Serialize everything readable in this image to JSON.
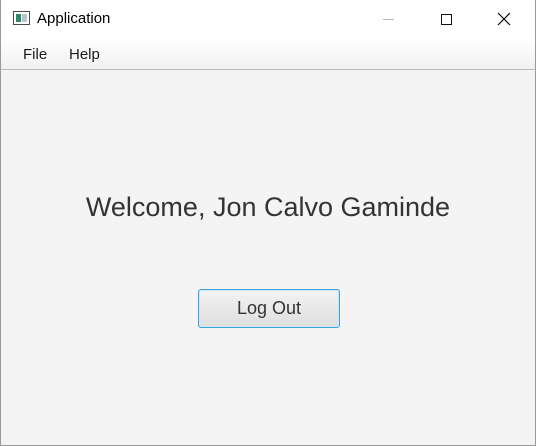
{
  "window": {
    "title": "Application",
    "icon": "app-window-icon",
    "controls": [
      "minimize-icon",
      "maximize-icon",
      "close-icon"
    ]
  },
  "menubar": {
    "items": [
      {
        "label": "File"
      },
      {
        "label": "Help"
      }
    ]
  },
  "main": {
    "welcome_text": "Welcome, Jon Calvo Gaminde",
    "logout_label": "Log Out"
  },
  "colors": {
    "background": "#f4f4f4",
    "button_focus_border": "#3c9fe0",
    "text": "#333333"
  }
}
